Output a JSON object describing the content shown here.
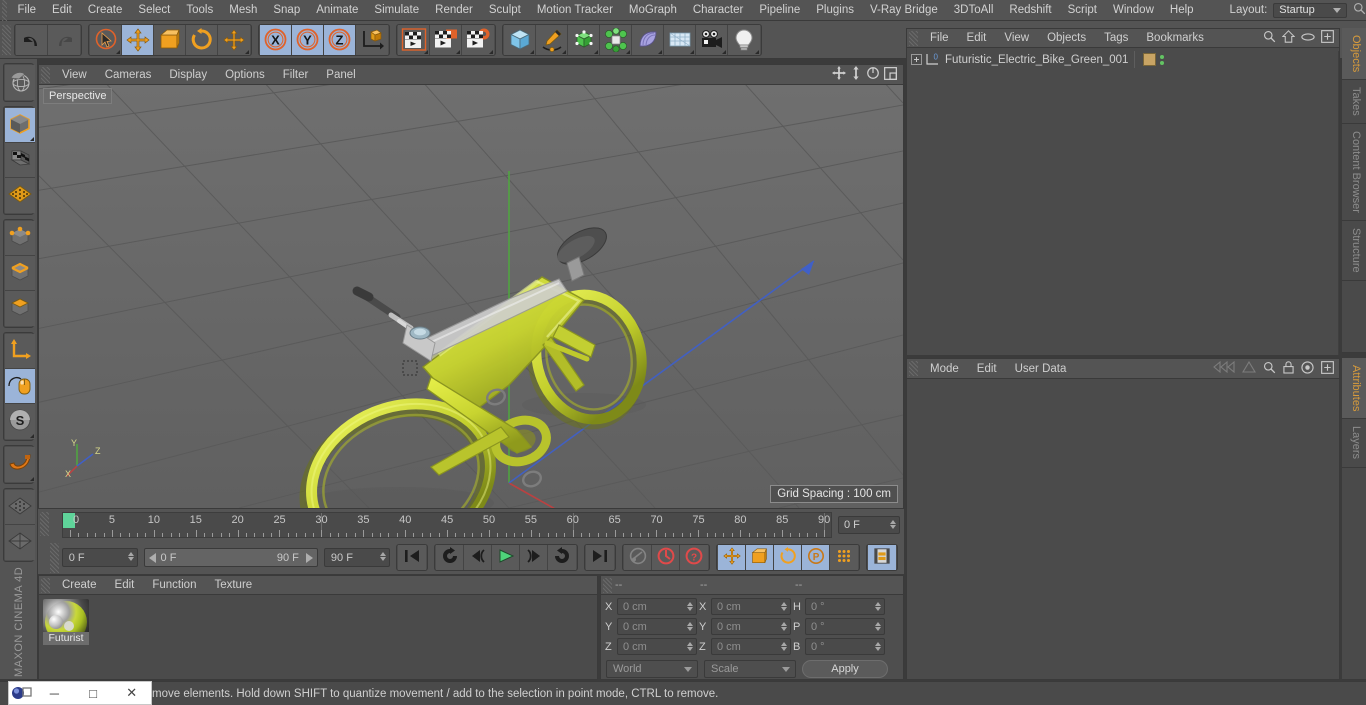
{
  "app": {
    "brand": "MAXON CINEMA 4D",
    "layout_label": "Layout:",
    "layout_value": "Startup"
  },
  "menubar": {
    "items": [
      {
        "label": "File"
      },
      {
        "label": "Edit"
      },
      {
        "label": "Create"
      },
      {
        "label": "Select"
      },
      {
        "label": "Tools"
      },
      {
        "label": "Mesh"
      },
      {
        "label": "Snap"
      },
      {
        "label": "Animate"
      },
      {
        "label": "Simulate"
      },
      {
        "label": "Render"
      },
      {
        "label": "Sculpt"
      },
      {
        "label": "Motion Tracker"
      },
      {
        "label": "MoGraph"
      },
      {
        "label": "Character"
      },
      {
        "label": "Pipeline"
      },
      {
        "label": "Plugins"
      },
      {
        "label": "V-Ray Bridge"
      },
      {
        "label": "3DToAll"
      },
      {
        "label": "Redshift"
      },
      {
        "label": "Script"
      },
      {
        "label": "Window"
      },
      {
        "label": "Help"
      }
    ]
  },
  "toolbar": {
    "groups": [
      {
        "buttons": [
          {
            "icon": "undo-icon",
            "active": false,
            "corner": false
          },
          {
            "icon": "redo-icon",
            "active": false,
            "corner": false
          }
        ]
      },
      {
        "buttons": [
          {
            "icon": "live-selection-icon",
            "active": false,
            "corner": true
          },
          {
            "icon": "move-tool-icon",
            "active": true,
            "corner": false
          },
          {
            "icon": "scale-tool-icon",
            "active": false,
            "corner": false
          },
          {
            "icon": "rotate-tool-icon",
            "active": false,
            "corner": false
          },
          {
            "icon": "move-alt-icon",
            "active": false,
            "corner": true
          }
        ]
      },
      {
        "buttons": [
          {
            "icon": "x-axis-lock-icon",
            "active": true,
            "corner": false
          },
          {
            "icon": "y-axis-lock-icon",
            "active": true,
            "corner": false
          },
          {
            "icon": "z-axis-lock-icon",
            "active": true,
            "corner": false
          },
          {
            "icon": "world-coordinate-icon",
            "active": false,
            "corner": false
          }
        ]
      },
      {
        "buttons": [
          {
            "icon": "render-view-icon",
            "active": false,
            "corner": true
          },
          {
            "icon": "render-region-icon",
            "active": false,
            "corner": true
          },
          {
            "icon": "render-settings-icon",
            "active": false,
            "corner": true
          }
        ]
      },
      {
        "buttons": [
          {
            "icon": "cube-primitive-icon",
            "active": false,
            "corner": true
          },
          {
            "icon": "spline-pen-icon",
            "active": false,
            "corner": true
          },
          {
            "icon": "nurbs-generator-icon",
            "active": false,
            "corner": true
          },
          {
            "icon": "array-modeling-icon",
            "active": false,
            "corner": true
          },
          {
            "icon": "deformer-icon",
            "active": false,
            "corner": true
          },
          {
            "icon": "environment-floor-icon",
            "active": false,
            "corner": true
          },
          {
            "icon": "camera-icon",
            "active": false,
            "corner": true
          },
          {
            "icon": "light-icon",
            "active": false,
            "corner": true
          }
        ]
      }
    ]
  },
  "left_toolbar": {
    "groups": [
      {
        "buttons": [
          {
            "icon": "viewport-navigation-icon",
            "active": false,
            "corner": false
          }
        ]
      },
      {
        "buttons": [
          {
            "icon": "model-mode-icon",
            "active": true,
            "corner": true
          },
          {
            "icon": "texture-mode-icon",
            "active": false,
            "corner": false
          },
          {
            "icon": "workplane-mode-icon",
            "active": false,
            "corner": false
          }
        ]
      },
      {
        "buttons": [
          {
            "icon": "point-mode-icon",
            "active": false,
            "corner": false
          },
          {
            "icon": "edge-mode-icon",
            "active": false,
            "corner": false
          },
          {
            "icon": "polygon-mode-icon",
            "active": false,
            "corner": false
          }
        ]
      },
      {
        "buttons": [
          {
            "icon": "object-axis-icon",
            "active": false,
            "corner": false
          },
          {
            "icon": "enable-snapping-icon",
            "active": true,
            "corner": false
          },
          {
            "icon": "soft-selection-icon",
            "active": false,
            "corner": true
          }
        ]
      },
      {
        "buttons": [
          {
            "icon": "magnet-tool-icon",
            "active": false,
            "corner": true
          }
        ]
      },
      {
        "buttons": [
          {
            "icon": "workplane-lock-icon",
            "active": false,
            "corner": false
          },
          {
            "icon": "workplane-align-icon",
            "active": false,
            "corner": false
          }
        ]
      }
    ]
  },
  "viewport": {
    "menu": [
      {
        "label": "View"
      },
      {
        "label": "Cameras"
      },
      {
        "label": "Display"
      },
      {
        "label": "Options"
      },
      {
        "label": "Filter"
      },
      {
        "label": "Panel"
      }
    ],
    "label": "Perspective",
    "grid_spacing": "Grid Spacing : 100 cm",
    "axis_labels": {
      "x": "X",
      "y": "Y",
      "z": "Z"
    },
    "corner_icons": [
      {
        "icon": "viewport-pan-icon"
      },
      {
        "icon": "viewport-dolly-icon"
      },
      {
        "icon": "viewport-rotate-icon"
      },
      {
        "icon": "viewport-maximize-icon"
      }
    ]
  },
  "timeline": {
    "ticks": [
      0,
      5,
      10,
      15,
      20,
      25,
      30,
      35,
      40,
      45,
      50,
      55,
      60,
      65,
      70,
      75,
      80,
      85,
      90
    ],
    "range_start": 0,
    "range_end": 90,
    "current_frame_field": "0 F"
  },
  "playbar": {
    "current_frame": "0 F",
    "preview_min": "0 F",
    "preview_max": "90 F",
    "doc_end": "90 F",
    "buttons": [
      {
        "icon": "go-to-start-icon",
        "active": false
      },
      {
        "icon": "previous-key-icon",
        "active": false
      },
      {
        "icon": "step-back-icon",
        "active": false
      },
      {
        "icon": "play-icon",
        "active": false
      },
      {
        "icon": "step-forward-icon",
        "active": false
      },
      {
        "icon": "next-key-icon",
        "active": false
      },
      {
        "icon": "go-to-end-icon",
        "active": false
      },
      {
        "icon": "record-key-icon",
        "active": false
      },
      {
        "icon": "autokeying-icon",
        "active": false
      },
      {
        "icon": "keyframe-selection-icon",
        "active": false
      },
      {
        "icon": "key-position-icon",
        "active": true
      },
      {
        "icon": "key-scale-icon",
        "active": true
      },
      {
        "icon": "key-rotation-icon",
        "active": true
      },
      {
        "icon": "key-parameter-icon",
        "active": true
      },
      {
        "icon": "key-pla-icon",
        "active": false
      },
      {
        "icon": "timeline-toggle-icon",
        "active": true
      }
    ]
  },
  "material_manager": {
    "menu": [
      {
        "label": "Create"
      },
      {
        "label": "Edit"
      },
      {
        "label": "Function"
      },
      {
        "label": "Texture"
      }
    ],
    "materials": [
      {
        "name": "Futurist"
      }
    ]
  },
  "coordinates": {
    "headers": [
      "--",
      "--",
      "--"
    ],
    "rows": [
      {
        "pos_label": "X",
        "pos_value": "0 cm",
        "size_label": "X",
        "size_value": "0 cm",
        "rot_label": "H",
        "rot_value": "0 °"
      },
      {
        "pos_label": "Y",
        "pos_value": "0 cm",
        "size_label": "Y",
        "size_value": "0 cm",
        "rot_label": "P",
        "rot_value": "0 °"
      },
      {
        "pos_label": "Z",
        "pos_value": "0 cm",
        "size_label": "Z",
        "size_value": "0 cm",
        "rot_label": "B",
        "rot_value": "0 °"
      }
    ],
    "system": "World",
    "mode": "Scale",
    "apply_label": "Apply"
  },
  "object_manager": {
    "menu": [
      {
        "label": "File"
      },
      {
        "label": "Edit"
      },
      {
        "label": "View"
      },
      {
        "label": "Objects"
      },
      {
        "label": "Tags"
      },
      {
        "label": "Bookmarks"
      }
    ],
    "icons": [
      {
        "icon": "search-icon"
      },
      {
        "icon": "home-icon"
      },
      {
        "icon": "ellipse-icon"
      },
      {
        "icon": "new-layout-icon"
      }
    ],
    "objects": [
      {
        "name": "Futuristic_Electric_Bike_Green_001",
        "type": "null-object",
        "expandable": true
      }
    ]
  },
  "attributes_manager": {
    "menu": [
      {
        "label": "Mode"
      },
      {
        "label": "Edit"
      },
      {
        "label": "User Data"
      }
    ],
    "icons": [
      {
        "icon": "nav-back-icon"
      },
      {
        "icon": "nav-forward-icon"
      },
      {
        "icon": "search-icon"
      },
      {
        "icon": "lock-icon"
      },
      {
        "icon": "target-icon"
      },
      {
        "icon": "new-layout-icon"
      }
    ]
  },
  "right_tabs_top": [
    {
      "label": "Objects",
      "active": true
    },
    {
      "label": "Takes",
      "active": false
    },
    {
      "label": "Content Browser",
      "active": false
    },
    {
      "label": "Structure",
      "active": false
    }
  ],
  "right_tabs_bottom": [
    {
      "label": "Attributes",
      "active": true
    },
    {
      "label": "Layers",
      "active": false
    }
  ],
  "statusbar": {
    "message": "move elements. Hold down SHIFT to quantize movement / add to the selection in point mode, CTRL to remove."
  },
  "taskbar": {
    "minimize": "─",
    "maximize": "□",
    "close": "✕"
  },
  "colors": {
    "accent_orange": "#e08b2a",
    "active_blue": "#9bb4d8",
    "panel_bg": "#4b4b4b",
    "chrome_bg": "#545454",
    "bike_green": "#c9d83a"
  }
}
